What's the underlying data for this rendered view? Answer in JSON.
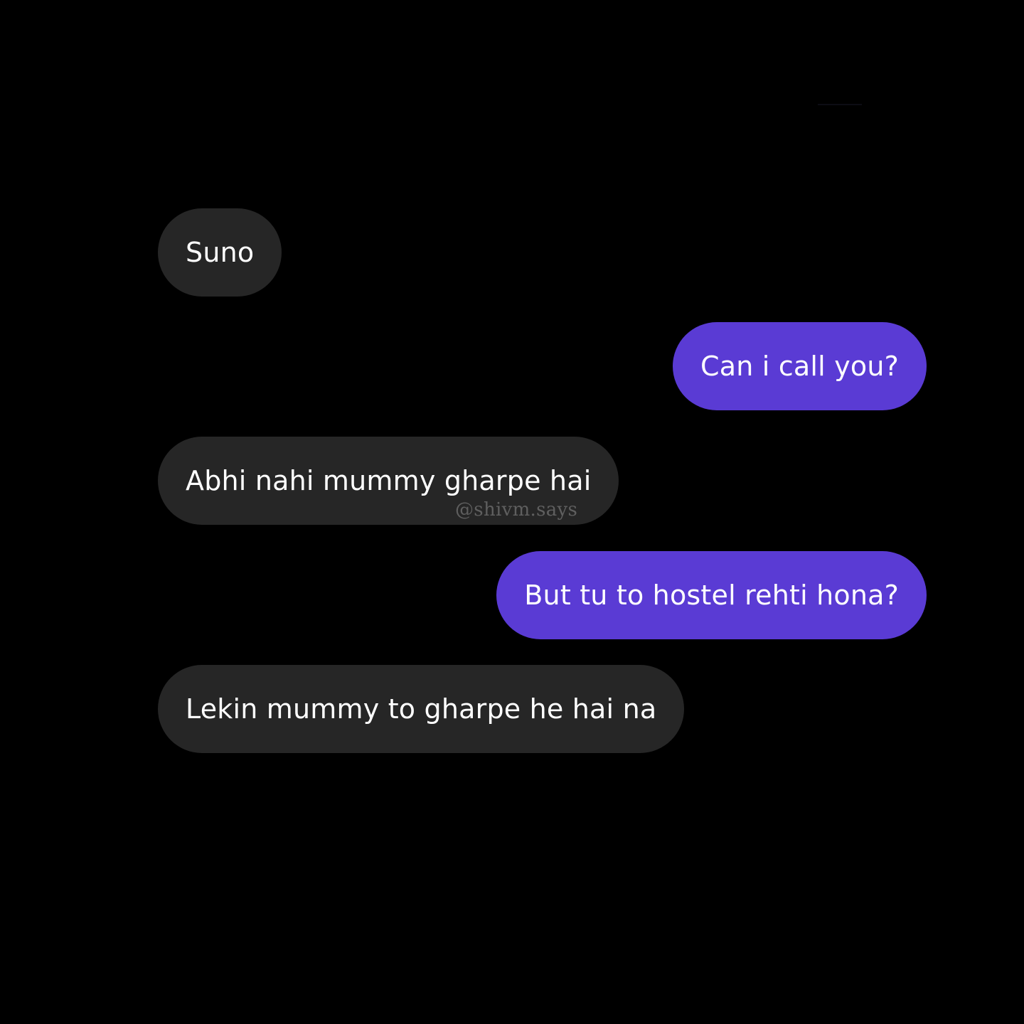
{
  "theme": {
    "background": "#000000",
    "incoming_bubble": "#262626",
    "outgoing_bubble": "#5a3bd4",
    "text": "#ffffff",
    "watermark": "#5f5f5f"
  },
  "messages": [
    {
      "sender": "them",
      "text": "Suno"
    },
    {
      "sender": "me",
      "text": "Can i call you?"
    },
    {
      "sender": "them",
      "text": "Abhi nahi mummy gharpe hai"
    },
    {
      "sender": "me",
      "text": "But tu to hostel rehti hona?"
    },
    {
      "sender": "them",
      "text": "Lekin mummy to gharpe he hai na"
    }
  ],
  "watermark": "@shivm.says"
}
